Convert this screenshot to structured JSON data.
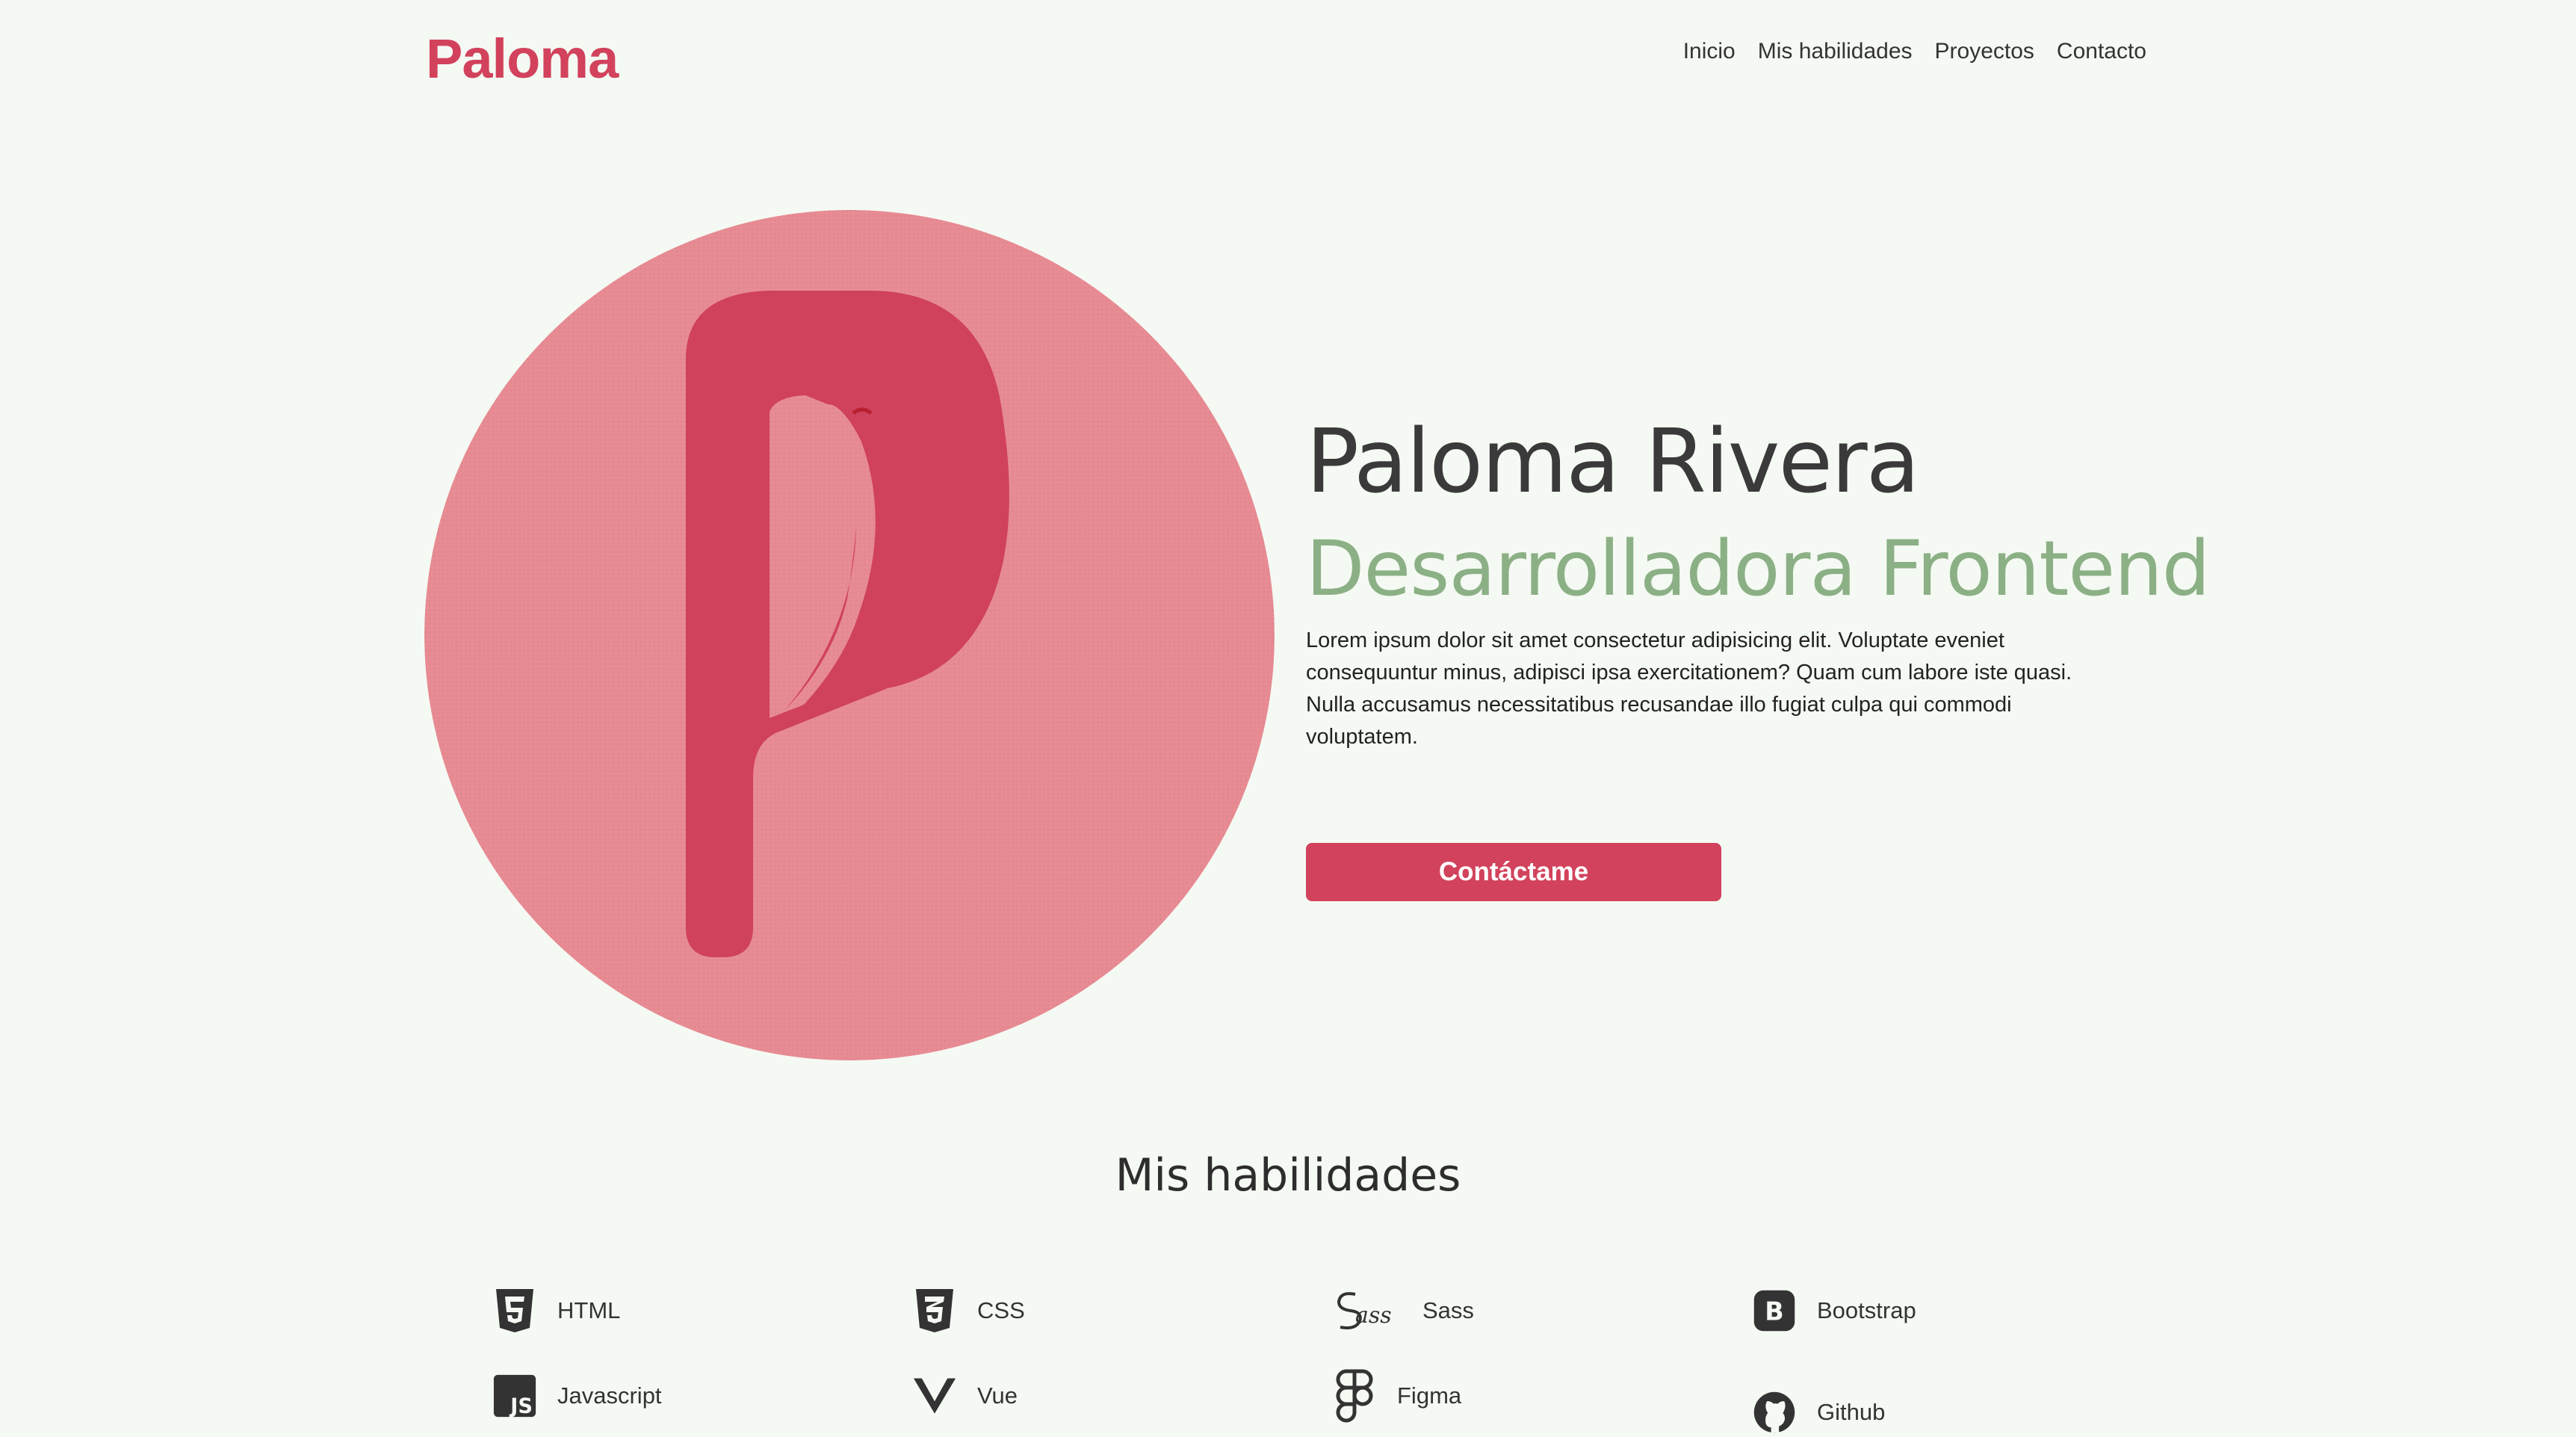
{
  "brand": {
    "logo": "Paloma",
    "accent": "#d2425c",
    "secondary": "#8bb085"
  },
  "nav": [
    "Inicio",
    "Mis habilidades",
    "Proyectos",
    "Contacto"
  ],
  "hero": {
    "name": "Paloma Rivera",
    "role": "Desarrolladora Frontend",
    "description": "Lorem ipsum dolor sit amet consectetur adipisicing elit. Voluptate eveniet consequuntur minus, adipisci ipsa exercitationem? Quam cum labore iste quasi. Nulla accusamus necessitatibus recusandae illo fugiat culpa qui commodi voluptatem.",
    "cta": "Contáctame",
    "image_icon": "p-bird-logo"
  },
  "skills": {
    "title": "Mis habilidades",
    "items": [
      {
        "label": "HTML",
        "icon": "html5-icon"
      },
      {
        "label": "CSS",
        "icon": "css3-icon"
      },
      {
        "label": "Sass",
        "icon": "sass-icon"
      },
      {
        "label": "Bootstrap",
        "icon": "bootstrap-icon"
      },
      {
        "label": "Javascript",
        "icon": "js-icon"
      },
      {
        "label": "Vue",
        "icon": "vue-icon"
      },
      {
        "label": "Figma",
        "icon": "figma-icon"
      },
      {
        "label": "Github",
        "icon": "github-icon"
      }
    ]
  }
}
